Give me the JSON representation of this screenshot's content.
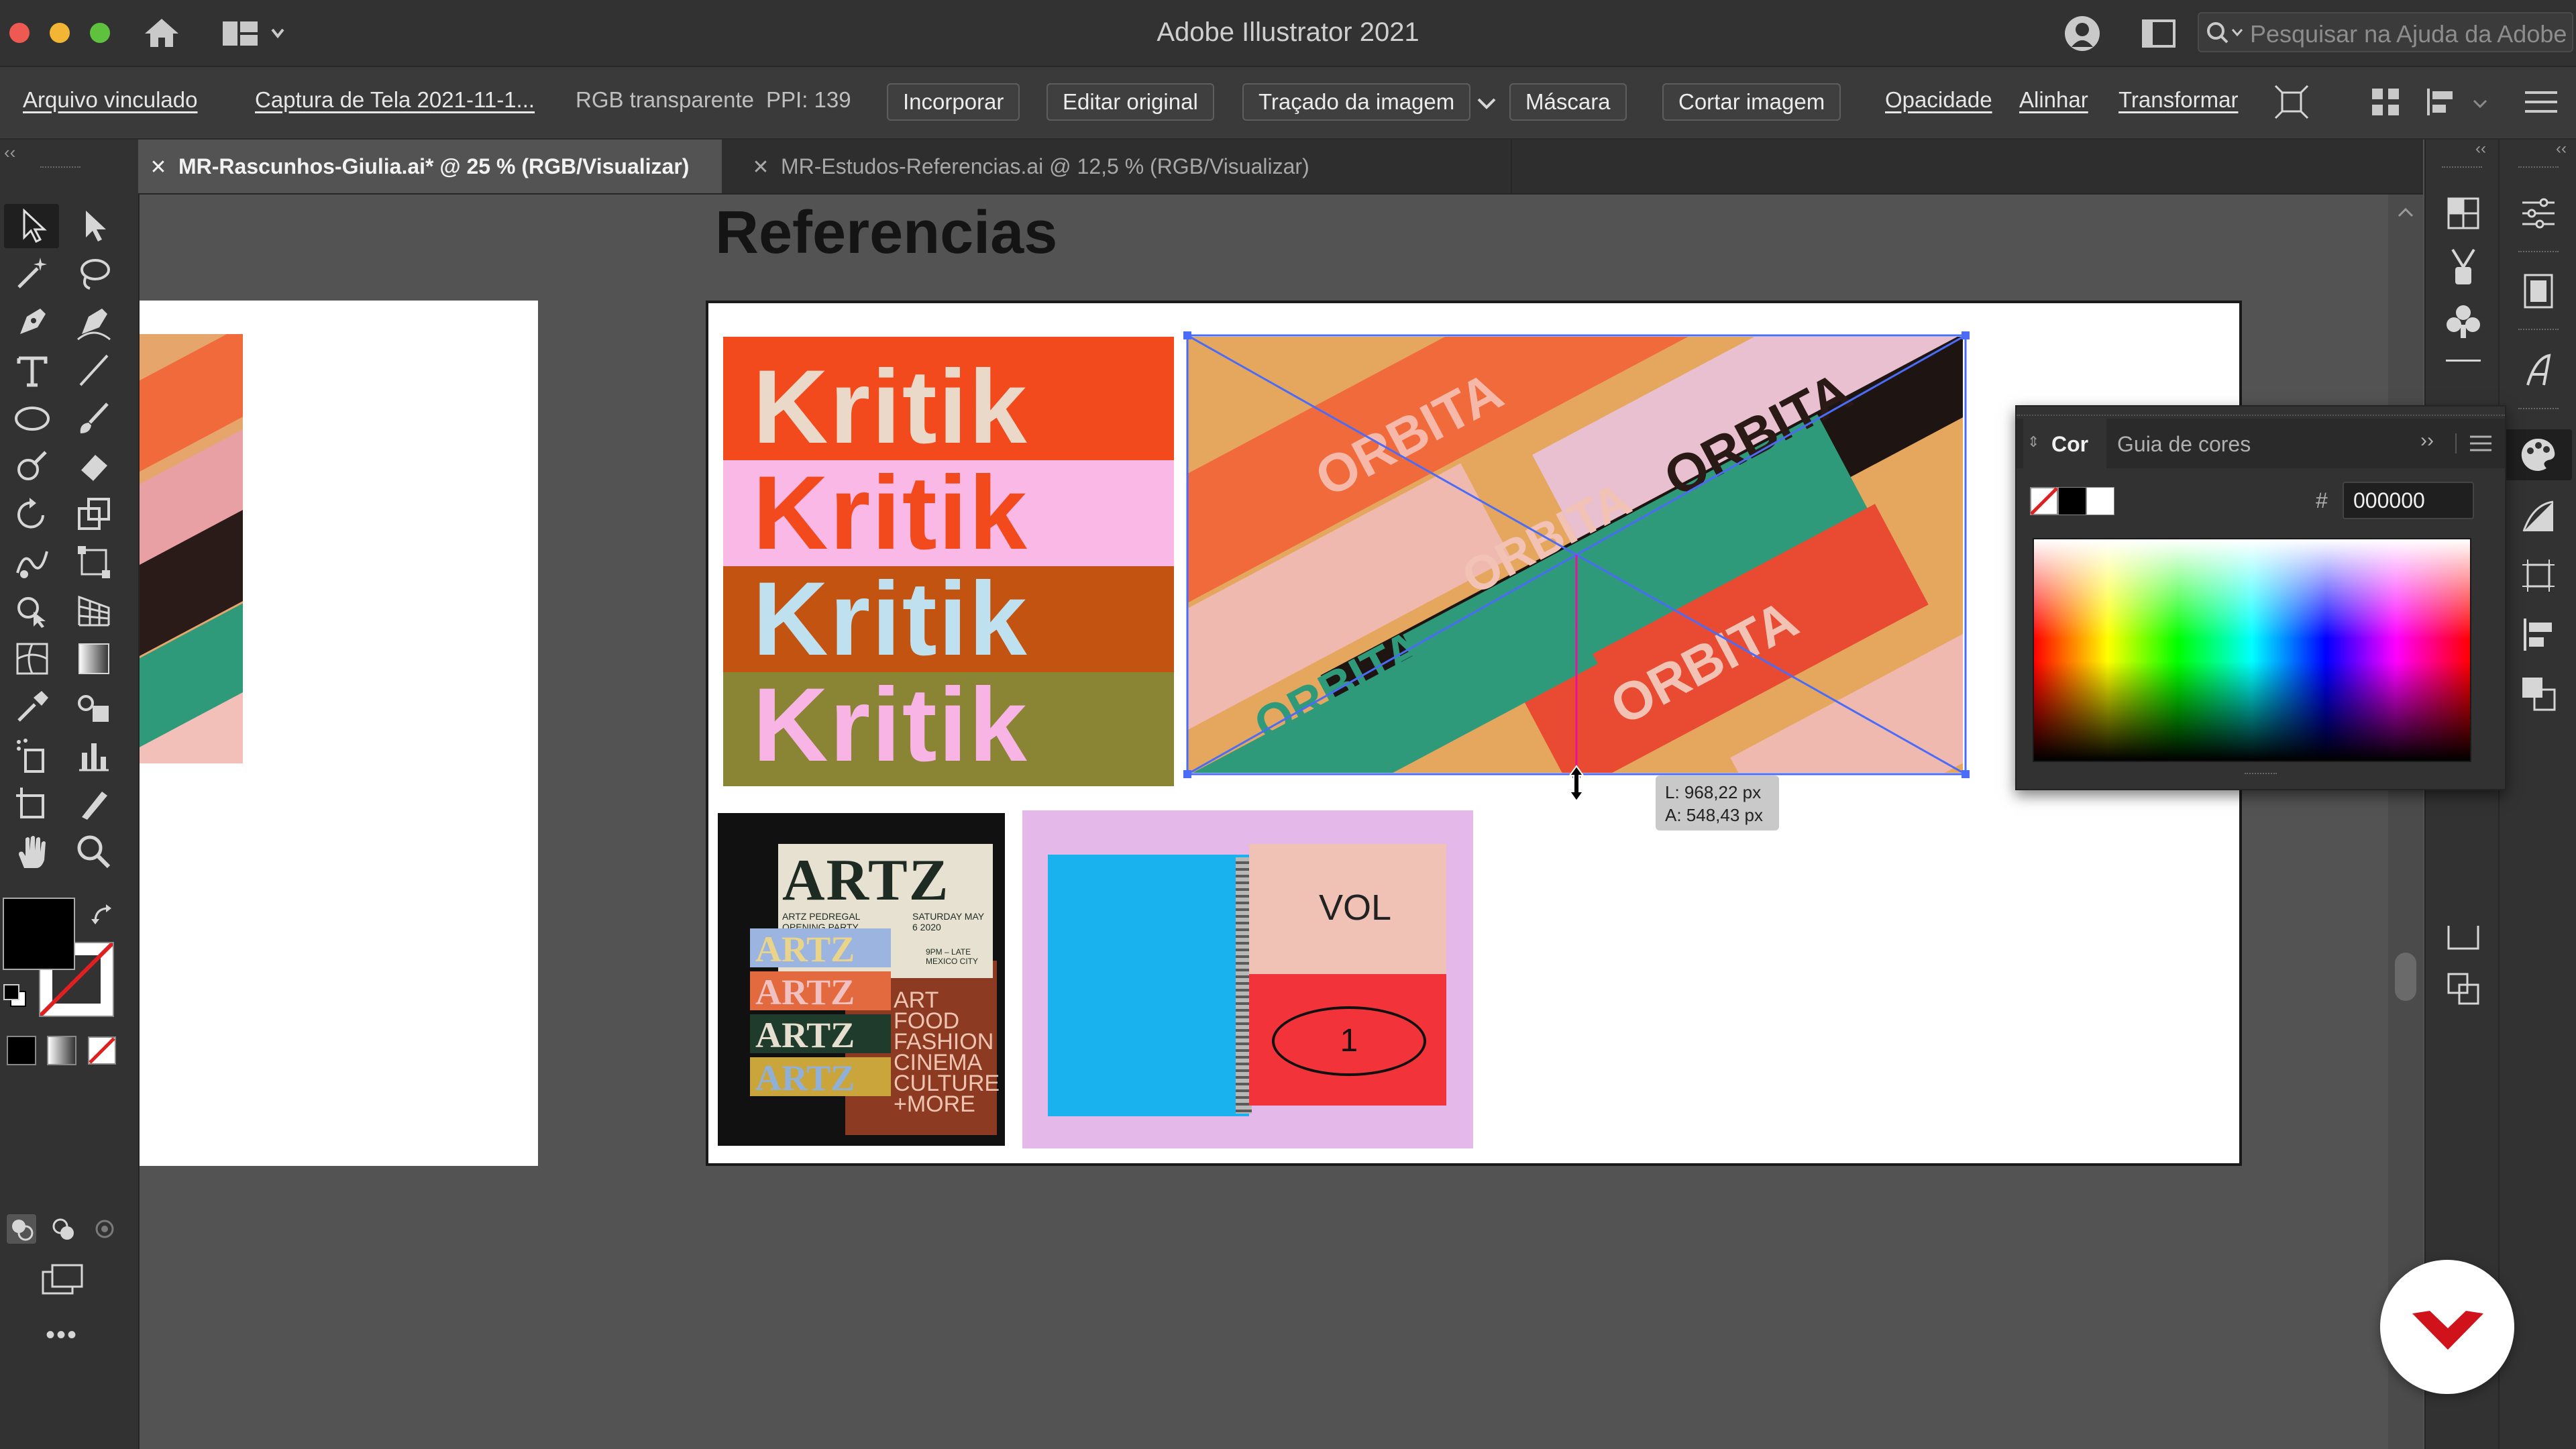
{
  "window": {
    "title": "Adobe Illustrator 2021",
    "search_placeholder": "Pesquisar na Ajuda da Adobe"
  },
  "control_bar": {
    "linked_file": "Arquivo vinculado",
    "file_name": "Captura de Tela 2021-11-1...",
    "color_mode": "RGB transparente",
    "ppi": "PPI: 139",
    "embed": "Incorporar",
    "edit_original": "Editar original",
    "image_trace": "Traçado da imagem",
    "mask": "Máscara",
    "crop_image": "Cortar imagem",
    "opacity": "Opacidade",
    "align": "Alinhar",
    "transform": "Transformar"
  },
  "tabs": [
    {
      "label": "MR-Rascunhos-Giulia.ai* @ 25 % (RGB/Visualizar)",
      "active": true
    },
    {
      "label": "MR-Estudos-Referencias.ai @ 12,5 % (RGB/Visualizar)",
      "active": false
    }
  ],
  "artboard": {
    "title": "Referencias"
  },
  "images": {
    "kritik": [
      "Kritik",
      "Kritik",
      "Kritik",
      "Kritik"
    ],
    "orbita_word": "ORBITA",
    "artz": {
      "title": "ARTZ",
      "sub_left": "ARTZ PEDREGAL OPENING PARTY",
      "sub_right": "SATURDAY MAY 6 2020",
      "time": "9PM – LATE MEXICO CITY",
      "stack": [
        "ARTZ",
        "ARTZ",
        "ARTZ",
        "ARTZ"
      ],
      "lines": [
        "ART",
        "FOOD",
        "FASHION",
        "CINEMA",
        "CULTURE",
        "+MORE"
      ]
    },
    "notebook": {
      "vol": "VOL",
      "number": "1"
    }
  },
  "selection_tooltip": {
    "width": "L: 968,22 px",
    "height": "A: 548,43 px"
  },
  "color_panel": {
    "tab_color": "Cor",
    "tab_guide": "Guia de cores",
    "hash": "#",
    "hex_value": "000000"
  },
  "colors": {
    "ui_dark": "#323232",
    "canvas": "#535353",
    "selection": "#4a6cf7",
    "kritik_red": "#f24a1d",
    "kritik_pink": "#f9b8e6",
    "kritik_orange": "#c25310",
    "kritik_olive": "#8a8534",
    "orbita_green": "#2f9a7a",
    "brand_red": "#d0131b"
  }
}
